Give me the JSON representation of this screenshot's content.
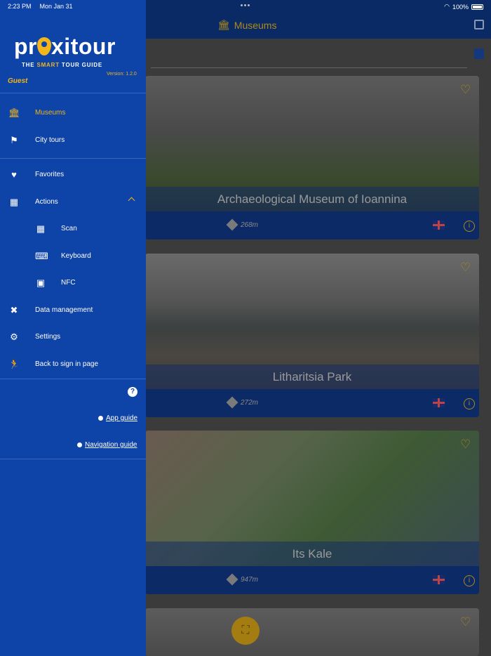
{
  "status": {
    "time": "2:23 PM",
    "date": "Mon Jan 31",
    "battery": "100%"
  },
  "header": {
    "title": "Museums",
    "title_icon": "museum-icon",
    "exit_icon": "exit-icon",
    "map_icon": "map-icon"
  },
  "drawer": {
    "logo_text_pre": "pr",
    "logo_text_post": "xitour",
    "tagline_pre": "THE ",
    "tagline_smart": "SMART",
    "tagline_post": " TOUR GUIDE",
    "version": "Version: 1.2.0",
    "user": "Guest",
    "items": [
      {
        "label": "Museums",
        "icon": "museum-icon"
      },
      {
        "label": "City tours",
        "icon": "flag-icon"
      },
      {
        "label": "Favorites",
        "icon": "heart-icon"
      },
      {
        "label": "Actions",
        "icon": "qr-icon"
      },
      {
        "label": "Scan",
        "icon": "qr-scan-icon"
      },
      {
        "label": "Keyboard",
        "icon": "keyboard-icon"
      },
      {
        "label": "NFC",
        "icon": "nfc-icon"
      },
      {
        "label": "Data management",
        "icon": "tools-icon"
      },
      {
        "label": "Settings",
        "icon": "gear-icon"
      },
      {
        "label": "Back to sign in page",
        "icon": "run-icon"
      }
    ],
    "help": "?",
    "app_guide": "App guide",
    "navigation_guide": "Navigation guide"
  },
  "cards": [
    {
      "name": "Archaeological Museum of Ioannina",
      "distance": "268m"
    },
    {
      "name": "Litharitsia Park",
      "distance": "272m"
    },
    {
      "name": "Its Kale",
      "distance": "947m"
    }
  ],
  "colors": {
    "drawer_bg": "#0e43a8",
    "accent": "#f2b51b",
    "header_bg": "#0a2a66"
  }
}
